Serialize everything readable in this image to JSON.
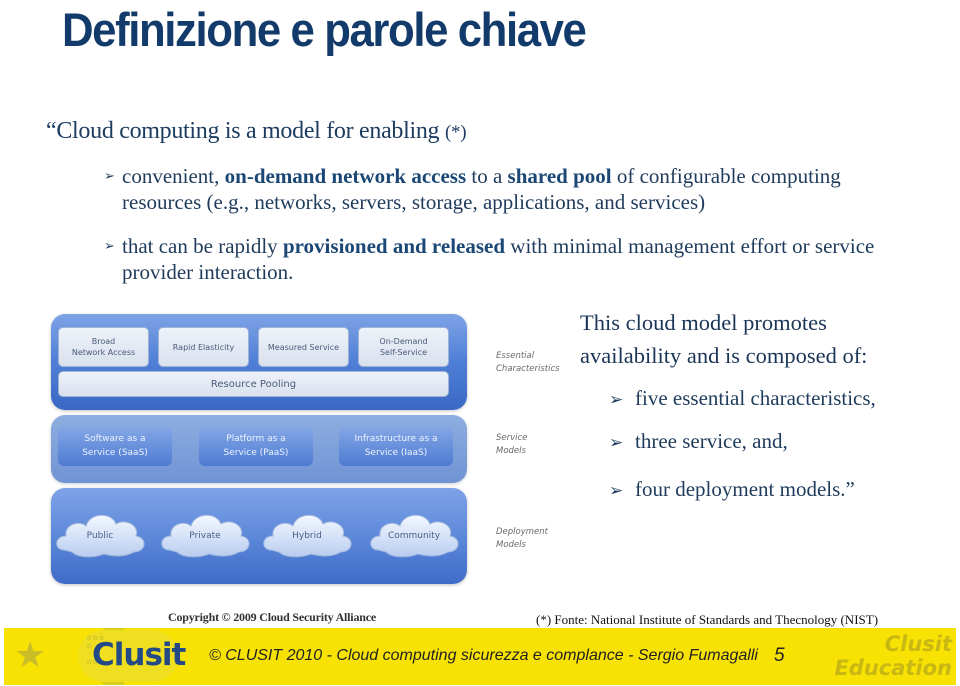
{
  "title": "Definizione e parole chiave",
  "quote_intro": {
    "text": "“Cloud computing is a model for enabling ",
    "ref": "(*)"
  },
  "bullets": [
    {
      "parts": [
        {
          "t": "convenient, ",
          "b": false
        },
        {
          "t": "on-demand network  access",
          "b": true
        },
        {
          "t": " to a ",
          "b": false
        },
        {
          "t": "shared pool",
          "b": true
        },
        {
          "t": " of configurable computing resources (e.g., networks, servers, storage, applications, and services)",
          "b": false
        }
      ]
    },
    {
      "parts": [
        {
          "t": "that can be rapidly ",
          "b": false
        },
        {
          "t": "provisioned and released",
          "b": true
        },
        {
          "t": " with minimal management effort or service provider interaction.",
          "b": false
        }
      ]
    }
  ],
  "diagram": {
    "essential": {
      "items": [
        "Broad\nNetwork Access",
        "Rapid Elasticity",
        "Measured Service",
        "On-Demand\nSelf-Service"
      ],
      "pool": "Resource Pooling",
      "label": "Essential\nCharacteristics"
    },
    "service": {
      "items": [
        "Software as a\nService (SaaS)",
        "Platform as a\nService (PaaS)",
        "Infrastructure as a\nService (IaaS)"
      ],
      "label": "Service\nModels"
    },
    "deployment": {
      "items": [
        "Public",
        "Private",
        "Hybrid",
        "Community"
      ],
      "label": "Deployment\nModels"
    }
  },
  "right": {
    "line1": "This cloud model promotes",
    "line2": "availability and is composed of:",
    "bullets": [
      "five essential characteristics,",
      "three service, and,",
      "four  deployment models.”"
    ]
  },
  "copyright": "Copyright © 2009 Cloud Security Alliance",
  "source": "(*) Fonte: National Institute of Standards and Thecnology (NIST)",
  "footer": {
    "logo": "Clusit",
    "text": "© CLUSIT 2010 - Cloud computing sicurezza e complance -  Sergio Fumagalli",
    "page": "5",
    "brand": "Clusit\nEducation"
  }
}
